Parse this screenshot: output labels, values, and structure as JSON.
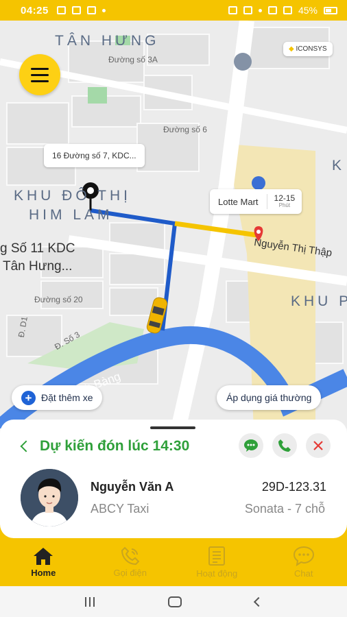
{
  "status": {
    "time": "04:25",
    "battery": "45%"
  },
  "map": {
    "labels": {
      "tan_hung": "TÂN HƯNG",
      "street_3a": "Đường số 3A",
      "street_6": "Đường số 6",
      "khu_do_thi": "KHU ĐÔ THỊ",
      "him_lam": "HIM LAM",
      "so11_line1": "g Số 11 KDC",
      "so11_line2": "Tân Hưng...",
      "street_20": "Đường số 20",
      "street_d1": "Đ. D1",
      "street_d3": "Đ. Số 3",
      "nguyen_thi_thap": "Nguyễn Thị Thập",
      "rach_bang": "rạch Bàng",
      "khu_right": "KHU P",
      "k_right": "K",
      "iconsys": "ICONSYS"
    },
    "pickup_tooltip": "16 Đường số 7, KDC...",
    "destination": {
      "name": "Lotte Mart",
      "eta_value": "12-15",
      "eta_unit": "Phút"
    },
    "add_car_label": "Đặt thêm xe",
    "pricing_label": "Áp dụng giá thường"
  },
  "trip": {
    "title": "Dự kiến đón lúc 14:30",
    "driver_name": "Nguyễn Văn A",
    "company": "ABCY Taxi",
    "plate": "29D-123.31",
    "car": "Sonata -  7 chỗ"
  },
  "nav": {
    "items": [
      {
        "label": "Home",
        "icon": "home-icon"
      },
      {
        "label": "Gọi điện",
        "icon": "phone-icon"
      },
      {
        "label": "Hoạt động",
        "icon": "activity-icon"
      },
      {
        "label": "Chat",
        "icon": "chat-icon"
      }
    ]
  },
  "colors": {
    "accent": "#f5c400",
    "route_blue": "#1f5bc9",
    "route_yellow": "#f5c400",
    "green": "#2fa03a",
    "red": "#e53935"
  }
}
